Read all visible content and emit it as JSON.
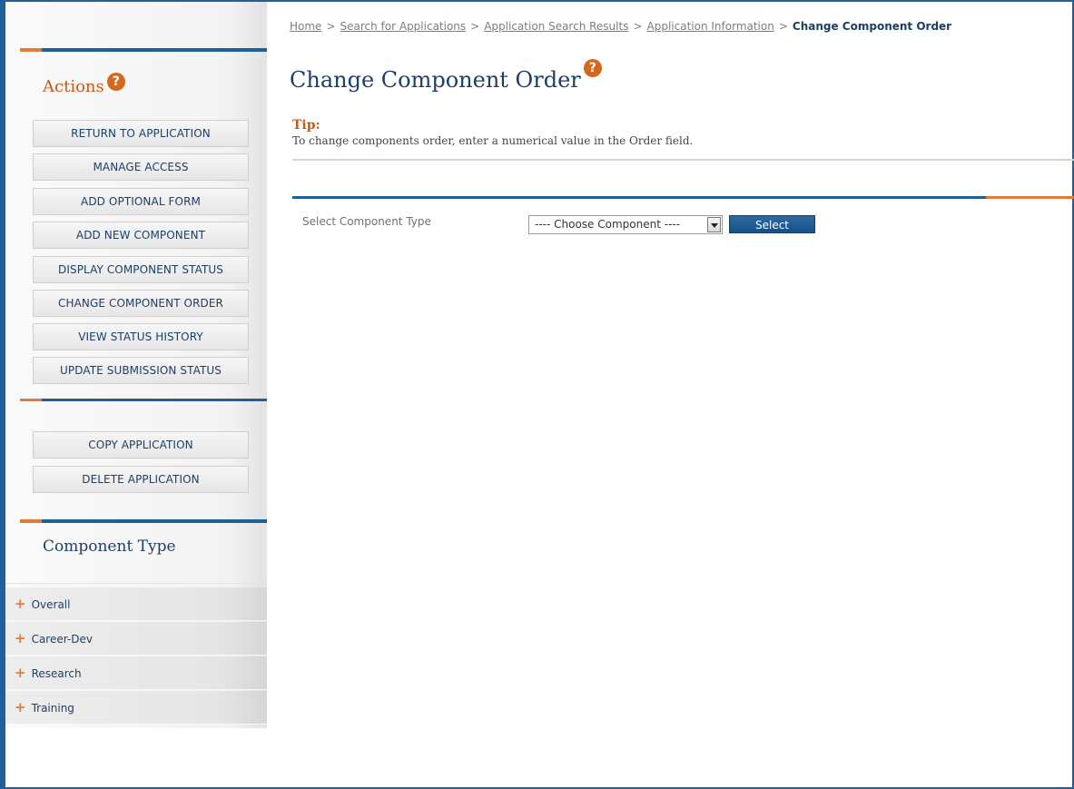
{
  "breadcrumb": {
    "items": [
      "Home",
      "Search for Applications",
      "Application Search Results",
      "Application Information"
    ],
    "current": "Change Component Order",
    "separator": ">"
  },
  "page": {
    "title": "Change Component Order",
    "help_icon": "question-icon"
  },
  "tip": {
    "label": "Tip:",
    "text": "To change components order, enter a numerical value in the Order field."
  },
  "sidebar": {
    "actions_title": "Actions",
    "actions": [
      "RETURN TO APPLICATION",
      "MANAGE ACCESS",
      "ADD OPTIONAL FORM",
      "ADD NEW COMPONENT",
      "DISPLAY COMPONENT STATUS",
      "CHANGE COMPONENT ORDER",
      "VIEW STATUS HISTORY",
      "UPDATE SUBMISSION STATUS"
    ],
    "secondary_actions": [
      "COPY APPLICATION",
      "DELETE APPLICATION"
    ],
    "component_type_title": "Component Type",
    "component_types": [
      "Overall",
      "Career-Dev",
      "Research",
      "Training"
    ],
    "expand_symbol": "+"
  },
  "form": {
    "field_label": "Select Component Type",
    "select_value": "---- Choose Component ----",
    "select_button": "Select"
  },
  "colors": {
    "primary_blue": "#1f5f9c",
    "accent_orange": "#e07b39",
    "heading_orange": "#c45a1b",
    "text_navy": "#1d3f66"
  }
}
